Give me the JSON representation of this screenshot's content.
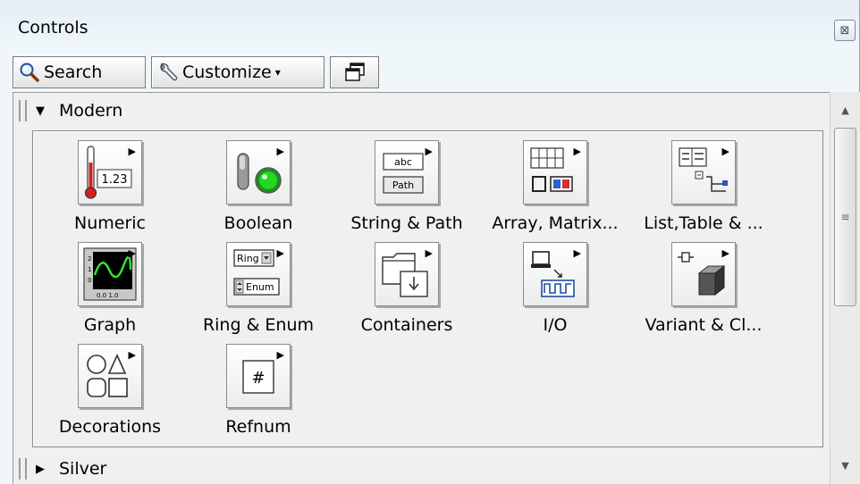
{
  "window": {
    "title": "Controls",
    "close_glyph": "⊠"
  },
  "toolbar": {
    "search_label": "Search",
    "customize_label": "Customize",
    "customize_arrow": "▾"
  },
  "sections": [
    {
      "label": "Modern",
      "expanded": true,
      "triangle": "▼"
    },
    {
      "label": "Silver",
      "expanded": false,
      "triangle": "▶"
    }
  ],
  "palette_items": [
    {
      "label": "Numeric",
      "icon": "numeric-control-icon",
      "icon_text": "1.23"
    },
    {
      "label": "Boolean",
      "icon": "boolean-control-icon"
    },
    {
      "label": "String & Path",
      "icon": "string-path-icon",
      "icon_text": "abc",
      "icon_text2": "Path"
    },
    {
      "label": "Array, Matrix...",
      "icon": "array-matrix-icon"
    },
    {
      "label": "List,Table & ...",
      "icon": "list-table-icon"
    },
    {
      "label": "Graph",
      "icon": "graph-icon"
    },
    {
      "label": "Ring & Enum",
      "icon": "ring-enum-icon",
      "icon_text": "Ring",
      "icon_text2": "Enum"
    },
    {
      "label": "Containers",
      "icon": "containers-icon"
    },
    {
      "label": "I/O",
      "icon": "io-icon"
    },
    {
      "label": "Variant & Cl...",
      "icon": "variant-class-icon"
    },
    {
      "label": "Decorations",
      "icon": "decorations-icon"
    },
    {
      "label": "Refnum",
      "icon": "refnum-icon",
      "icon_text": "#"
    }
  ],
  "scrollbar": {
    "up_glyph": "▲",
    "down_glyph": "▼",
    "thumb_grip": "≡"
  },
  "colors": {
    "title_bg": "#e4eef5",
    "panel_bg": "#f0f0f0",
    "led_green": "#22b022",
    "graph_green": "#2ee82e"
  }
}
